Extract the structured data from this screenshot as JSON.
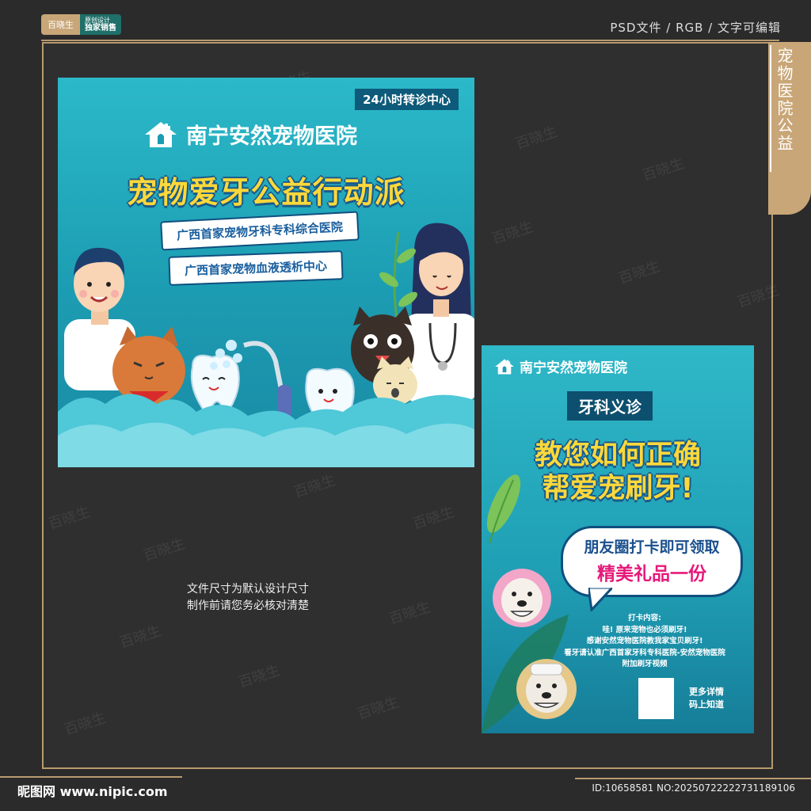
{
  "brand": {
    "badge_left": "百晓生",
    "badge_right_1": "原创设计",
    "badge_right_2": "独家销售"
  },
  "meta": "PSD文件  /  RGB /   文字可编辑",
  "side_title": "宠物医院公益",
  "watermark": "百晓生",
  "poster1": {
    "badge": "24小时转诊中心",
    "hospital": "南宁安然宠物医院",
    "headline": "宠物爱牙公益行动派",
    "ribbon1": "广西首家宠物牙科专科综合医院",
    "ribbon2": "广西首家宠物血液透析中心"
  },
  "poster2": {
    "hospital": "南宁安然宠物医院",
    "tag": "牙科义诊",
    "headline1": "教您如何正确",
    "headline2": "帮爱宠刷牙!",
    "bubble1": "朋友圈打卡即可领取",
    "bubble2": "精美礼品一份",
    "info": [
      "打卡内容:",
      "哇! 原来宠物也必须刷牙!",
      "感谢安然宠物医院教我家宝贝刷牙!",
      "看牙请认准广西首家牙科专科医院-安然宠物医院",
      "附加刷牙视频"
    ],
    "qr_text1": "更多详情",
    "qr_text2": "码上知道"
  },
  "note": {
    "line1": "文件尺寸为默认设计尺寸",
    "line2": "制作前请您务必核对清楚"
  },
  "footer": {
    "left": "昵图网 www.nipic.com",
    "right": "ID:10658581 NO:20250722222731189106"
  },
  "colors": {
    "gold": "#b89a6f",
    "teal": "#1c9cb2",
    "yellow": "#ffd83a",
    "pink": "#e6197a"
  }
}
